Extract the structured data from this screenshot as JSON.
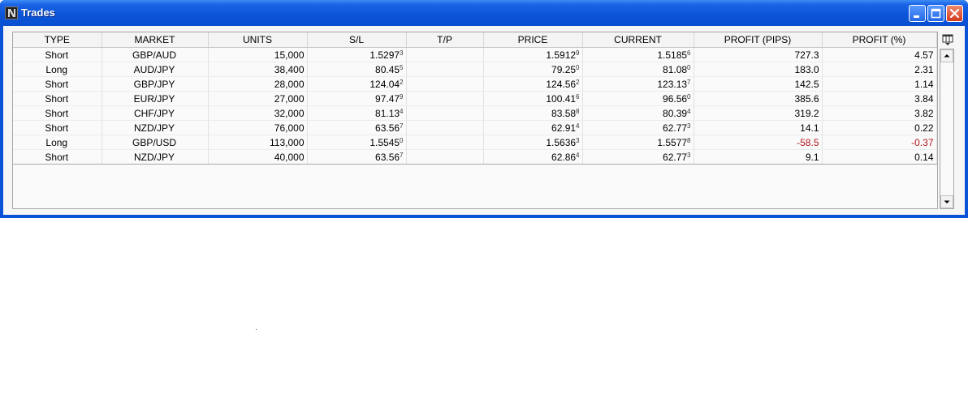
{
  "window": {
    "title": "Trades",
    "app_icon": "ninja-app-icon"
  },
  "colors": {
    "titlebar": "#0b55d9",
    "negative": "#b0171b",
    "close": "#d2391c"
  },
  "table": {
    "headers": [
      "TYPE",
      "MARKET",
      "UNITS",
      "S/L",
      "T/P",
      "PRICE",
      "CURRENT",
      "PROFIT (PIPS)",
      "PROFIT (%)"
    ],
    "rows": [
      {
        "type": "Short",
        "market": "GBP/AUD",
        "units": "15,000",
        "sl": "1.5297",
        "sl_sup": "3",
        "tp": "",
        "price": "1.5912",
        "price_sup": "9",
        "current": "1.5185",
        "current_sup": "6",
        "pips": "727.3",
        "pct": "4.57",
        "negative": false
      },
      {
        "type": "Long",
        "market": "AUD/JPY",
        "units": "38,400",
        "sl": "80.45",
        "sl_sup": "5",
        "tp": "",
        "price": "79.25",
        "price_sup": "0",
        "current": "81.08",
        "current_sup": "0",
        "pips": "183.0",
        "pct": "2.31",
        "negative": false
      },
      {
        "type": "Short",
        "market": "GBP/JPY",
        "units": "28,000",
        "sl": "124.04",
        "sl_sup": "2",
        "tp": "",
        "price": "124.56",
        "price_sup": "2",
        "current": "123.13",
        "current_sup": "7",
        "pips": "142.5",
        "pct": "1.14",
        "negative": false
      },
      {
        "type": "Short",
        "market": "EUR/JPY",
        "units": "27,000",
        "sl": "97.47",
        "sl_sup": "9",
        "tp": "",
        "price": "100.41",
        "price_sup": "6",
        "current": "96.56",
        "current_sup": "0",
        "pips": "385.6",
        "pct": "3.84",
        "negative": false
      },
      {
        "type": "Short",
        "market": "CHF/JPY",
        "units": "32,000",
        "sl": "81.13",
        "sl_sup": "4",
        "tp": "",
        "price": "83.58",
        "price_sup": "8",
        "current": "80.39",
        "current_sup": "4",
        "pips": "319.2",
        "pct": "3.82",
        "negative": false
      },
      {
        "type": "Short",
        "market": "NZD/JPY",
        "units": "76,000",
        "sl": "63.56",
        "sl_sup": "7",
        "tp": "",
        "price": "62.91",
        "price_sup": "4",
        "current": "62.77",
        "current_sup": "3",
        "pips": "14.1",
        "pct": "0.22",
        "negative": false
      },
      {
        "type": "Long",
        "market": "GBP/USD",
        "units": "113,000",
        "sl": "1.5545",
        "sl_sup": "0",
        "tp": "",
        "price": "1.5636",
        "price_sup": "3",
        "current": "1.5577",
        "current_sup": "8",
        "pips": "-58.5",
        "pct": "-0.37",
        "negative": true
      },
      {
        "type": "Short",
        "market": "NZD/JPY",
        "units": "40,000",
        "sl": "63.56",
        "sl_sup": "7",
        "tp": "",
        "price": "62.86",
        "price_sup": "4",
        "current": "62.77",
        "current_sup": "3",
        "pips": "9.1",
        "pct": "0.14",
        "negative": false
      }
    ]
  },
  "icons": {
    "minimize": "minimize-icon",
    "maximize": "maximize-icon",
    "close": "close-icon",
    "column_picker": "column-picker-icon",
    "scroll_up": "scroll-up-arrow-icon",
    "scroll_down": "scroll-down-arrow-icon"
  }
}
